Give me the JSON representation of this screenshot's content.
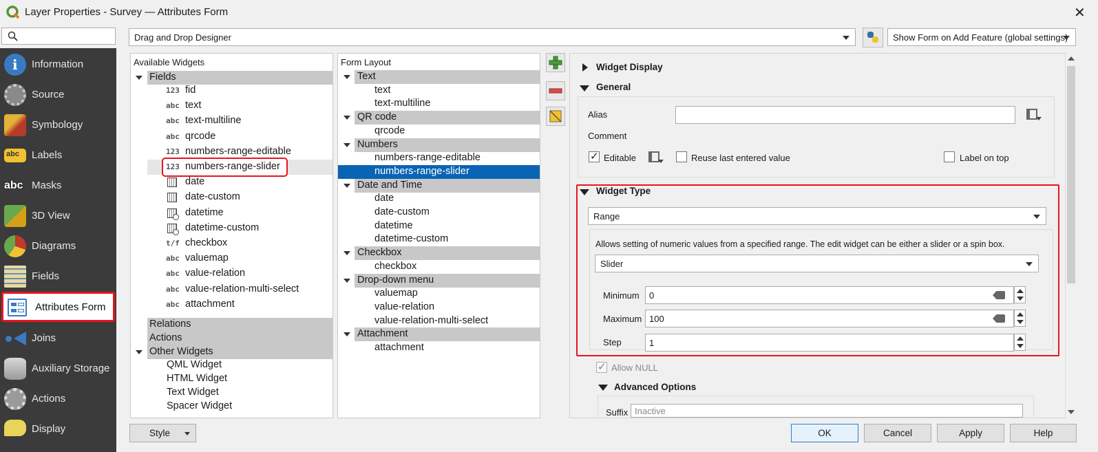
{
  "window": {
    "title": "Layer Properties - Survey — Attributes Form",
    "close": "✕"
  },
  "sidebar": {
    "items": [
      {
        "label": "Information",
        "icon": "information-icon"
      },
      {
        "label": "Source",
        "icon": "source-icon"
      },
      {
        "label": "Symbology",
        "icon": "symbology-icon"
      },
      {
        "label": "Labels",
        "icon": "labels-icon"
      },
      {
        "label": "Masks",
        "icon": "masks-icon"
      },
      {
        "label": "3D View",
        "icon": "3d-view-icon"
      },
      {
        "label": "Diagrams",
        "icon": "diagrams-icon"
      },
      {
        "label": "Fields",
        "icon": "fields-icon"
      },
      {
        "label": "Attributes Form",
        "icon": "attributes-form-icon"
      },
      {
        "label": "Joins",
        "icon": "joins-icon"
      },
      {
        "label": "Auxiliary Storage",
        "icon": "auxiliary-storage-icon"
      },
      {
        "label": "Actions",
        "icon": "actions-icon"
      },
      {
        "label": "Display",
        "icon": "display-icon"
      }
    ],
    "selected": "Attributes Form"
  },
  "toolbar": {
    "designer_mode": "Drag and Drop Designer",
    "show_form": "Show Form on Add Feature (global settings)"
  },
  "available_widgets": {
    "header": "Available Widgets",
    "fields_group": "Fields",
    "fields": [
      {
        "type": "123",
        "name": "fid"
      },
      {
        "type": "abc",
        "name": "text"
      },
      {
        "type": "abc",
        "name": "text-multiline"
      },
      {
        "type": "abc",
        "name": "qrcode"
      },
      {
        "type": "123",
        "name": "numbers-range-editable"
      },
      {
        "type": "123",
        "name": "numbers-range-slider"
      },
      {
        "type": "cal",
        "name": "date"
      },
      {
        "type": "cal",
        "name": "date-custom"
      },
      {
        "type": "clock",
        "name": "datetime"
      },
      {
        "type": "clock",
        "name": "datetime-custom"
      },
      {
        "type": "t/f",
        "name": "checkbox"
      },
      {
        "type": "abc",
        "name": "valuemap"
      },
      {
        "type": "abc",
        "name": "value-relation"
      },
      {
        "type": "abc",
        "name": "value-relation-multi-select"
      },
      {
        "type": "abc",
        "name": "attachment"
      }
    ],
    "relations": "Relations",
    "actions": "Actions",
    "other_group": "Other Widgets",
    "other": [
      "QML Widget",
      "HTML Widget",
      "Text Widget",
      "Spacer Widget"
    ]
  },
  "form_layout": {
    "header": "Form Layout",
    "groups": [
      {
        "name": "Text",
        "items": [
          "text",
          "text-multiline"
        ]
      },
      {
        "name": "QR code",
        "items": [
          "qrcode"
        ]
      },
      {
        "name": "Numbers",
        "items": [
          "numbers-range-editable",
          "numbers-range-slider"
        ]
      },
      {
        "name": "Date and Time",
        "items": [
          "date",
          "date-custom",
          "datetime",
          "datetime-custom"
        ]
      },
      {
        "name": "Checkbox",
        "items": [
          "checkbox"
        ]
      },
      {
        "name": "Drop-down menu",
        "items": [
          "valuemap",
          "value-relation",
          "value-relation-multi-select"
        ]
      },
      {
        "name": "Attachment",
        "items": [
          "attachment"
        ]
      }
    ],
    "selected": "numbers-range-slider"
  },
  "widget_display": {
    "title": "Widget Display"
  },
  "general": {
    "title": "General",
    "alias_label": "Alias",
    "alias_value": "",
    "comment_label": "Comment",
    "editable_label": "Editable",
    "editable": true,
    "reuse_label": "Reuse last entered value",
    "reuse": false,
    "label_on_top": "Label on top",
    "label_on_top_checked": false
  },
  "widget_type": {
    "title": "Widget Type",
    "type_value": "Range",
    "description": "Allows setting of numeric values from a specified range. The edit widget can be either a slider or a spin box.",
    "style_value": "Slider",
    "minimum_label": "Minimum",
    "minimum": "0",
    "maximum_label": "Maximum",
    "maximum": "100",
    "step_label": "Step",
    "step": "1",
    "allow_null_label": "Allow NULL",
    "allow_null": true
  },
  "advanced": {
    "title": "Advanced Options",
    "suffix_label": "Suffix",
    "suffix_placeholder": "Inactive"
  },
  "footer": {
    "style": "Style",
    "ok": "OK",
    "cancel": "Cancel",
    "apply": "Apply",
    "help": "Help"
  },
  "colors": {
    "sidebar_bg": "#3b3b3b",
    "selection": "#0a64b4",
    "highlight": "#e8141c",
    "group_bg": "#c8c8c8"
  }
}
